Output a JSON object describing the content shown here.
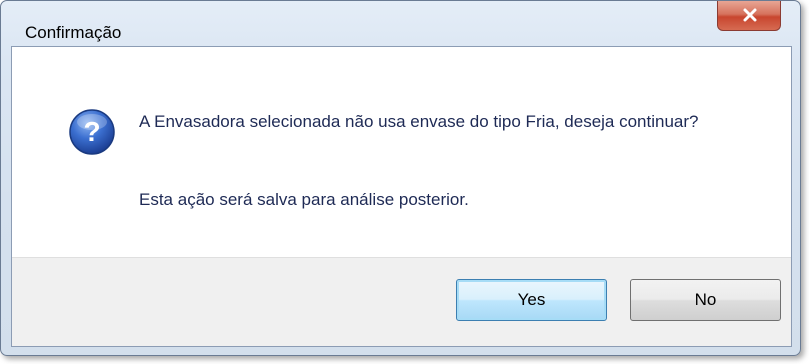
{
  "window": {
    "title": "Confirmação"
  },
  "dialog": {
    "icon": "question-icon",
    "message": "A Envasadora selecionada não usa envase do tipo Fria, deseja continuar?",
    "submessage": "Esta ação será salva para análise posterior."
  },
  "buttons": {
    "yes_label": "Yes",
    "no_label": "No",
    "close_icon": "close-icon"
  },
  "colors": {
    "close_button": "#c8462f",
    "message_text": "#1e2a55",
    "question_icon": "#2c5cb8",
    "default_button_border": "#3c7fb1"
  }
}
